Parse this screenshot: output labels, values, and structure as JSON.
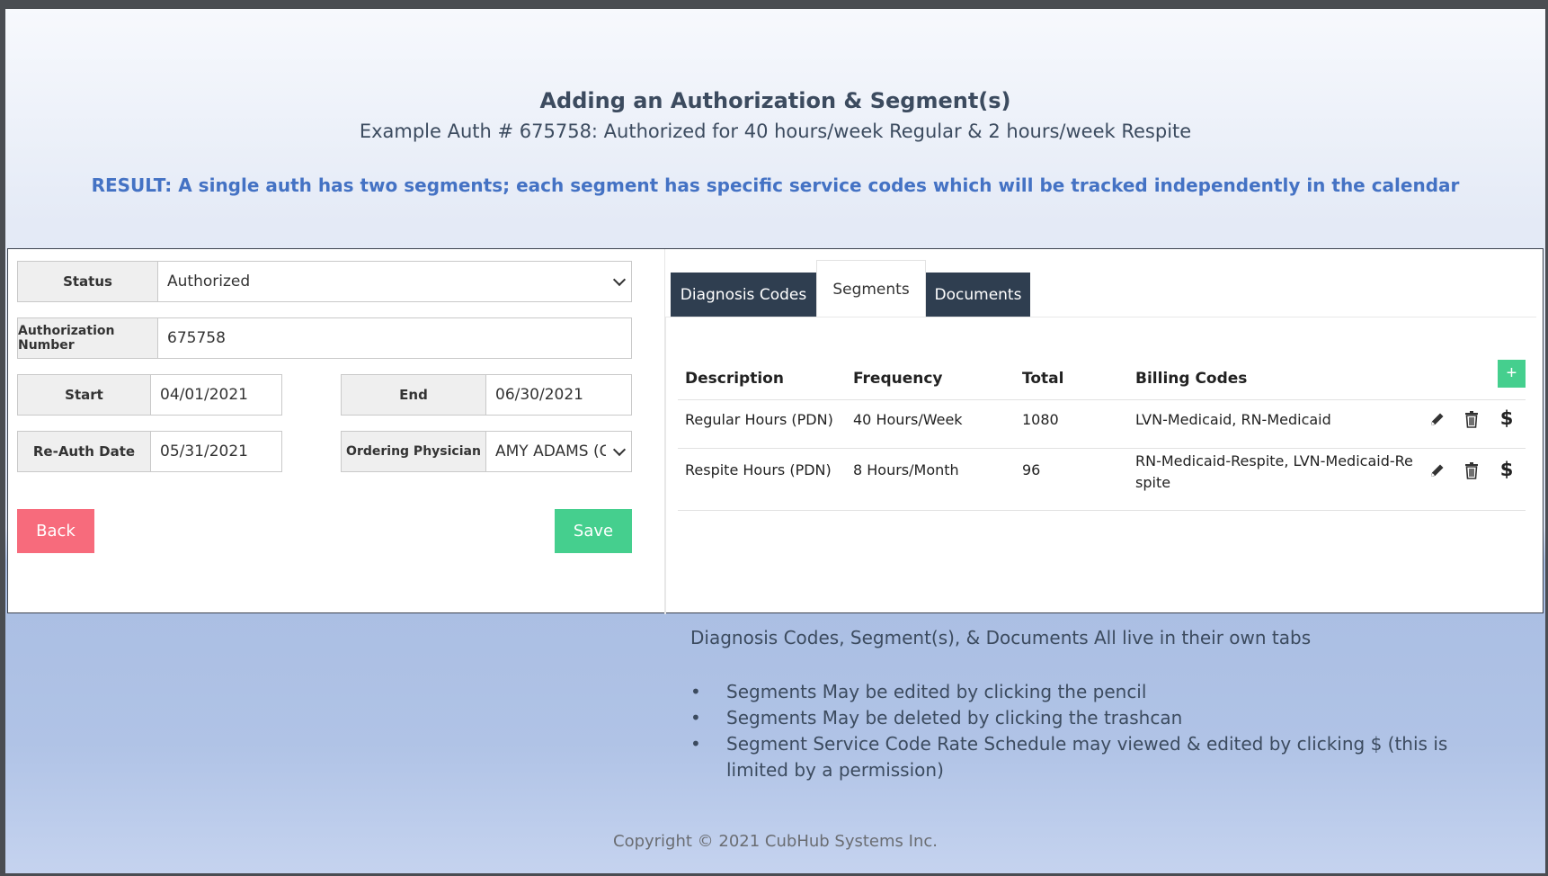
{
  "header": {
    "title": "Adding an Authorization & Segment(s)",
    "subtitle": "Example Auth # 675758: Authorized for 40 hours/week Regular & 2 hours/week Respite",
    "result": "RESULT: A single auth has two segments; each segment has specific service codes which will be tracked independently in the calendar"
  },
  "form": {
    "status_label": "Status",
    "status_value": "Authorized",
    "auth_number_label": "Authorization Number",
    "auth_number_value": "675758",
    "start_label": "Start",
    "start_value": "04/01/2021",
    "end_label": "End",
    "end_value": "06/30/2021",
    "reauth_label": "Re-Auth Date",
    "reauth_value": "05/31/2021",
    "physician_label": "Ordering Physician",
    "physician_value": "AMY ADAMS (C",
    "back_label": "Back",
    "save_label": "Save"
  },
  "tabs": [
    {
      "label": "Diagnosis Codes",
      "active": false
    },
    {
      "label": "Segments",
      "active": true
    },
    {
      "label": "Documents",
      "active": false
    }
  ],
  "segments": {
    "add_label": "+",
    "columns": [
      "Description",
      "Frequency",
      "Total",
      "Billing Codes"
    ],
    "rows": [
      {
        "description": "Regular Hours (PDN)",
        "frequency": "40 Hours/Week",
        "total": "1080",
        "billing_line1": "LVN-Medicaid, RN-Medicaid",
        "billing_line2": ""
      },
      {
        "description": "Respite Hours (PDN)",
        "frequency": "8 Hours/Month",
        "total": "96",
        "billing_line1": "RN-Medicaid-Respite, LVN-Medicaid-Re",
        "billing_line2": "spite"
      }
    ],
    "icons": {
      "edit": "pencil-icon",
      "delete": "trash-icon",
      "rates": "$"
    }
  },
  "notes": {
    "heading": "Diagnosis Codes, Segment(s), & Documents All live in their own tabs",
    "bullets": [
      "Segments May be edited by clicking the pencil",
      "Segments May be deleted by clicking the trashcan",
      "Segment Service Code Rate Schedule may viewed & edited by clicking $ (this is limited by a permission)"
    ]
  },
  "footer": {
    "copyright": "Copyright © 2021 CubHub Systems Inc."
  },
  "colors": {
    "tab_dark": "#2f3e50",
    "back_button": "#f76b7c",
    "save_button": "#45cf8e",
    "result_text": "#4472c4"
  }
}
